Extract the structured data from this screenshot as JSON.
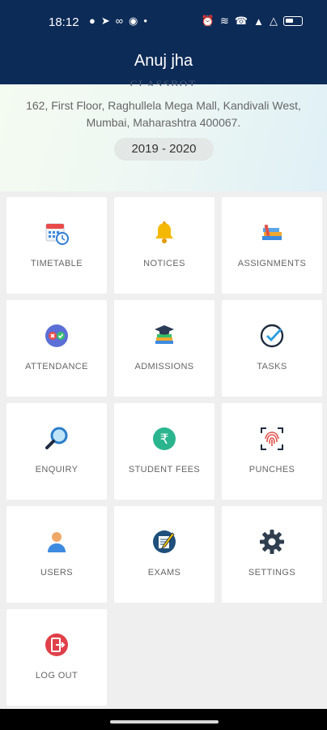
{
  "status_bar": {
    "time": "18:12",
    "left_icons": [
      "chat-icon",
      "telegram-icon",
      "link-icon",
      "messenger-icon",
      "dot-icon"
    ],
    "right_icons": [
      "alarm-icon",
      "wifi-icon",
      "wifi-call-icon",
      "signal-icon",
      "signal-2-icon",
      "battery-icon"
    ]
  },
  "app_bar": {
    "title": "Anuj jha"
  },
  "school": {
    "cut_name": "CLASSBOT",
    "address": "162, First Floor, Raghullela Mega Mall, Kandivali West, Mumbai, Maharashtra 400067.",
    "year": "2019 - 2020"
  },
  "tiles": [
    {
      "label": "TIMETABLE",
      "icon": "calendar-clock-icon"
    },
    {
      "label": "NOTICES",
      "icon": "bell-icon"
    },
    {
      "label": "ASSIGNMENTS",
      "icon": "books-icon"
    },
    {
      "label": "ATTENDANCE",
      "icon": "attendance-icon"
    },
    {
      "label": "ADMISSIONS",
      "icon": "graduation-cap-icon"
    },
    {
      "label": "TASKS",
      "icon": "check-circle-icon"
    },
    {
      "label": "ENQUIRY",
      "icon": "magnifier-icon"
    },
    {
      "label": "STUDENT FEES",
      "icon": "rupee-icon"
    },
    {
      "label": "PUNCHES",
      "icon": "fingerprint-icon"
    },
    {
      "label": "USERS",
      "icon": "user-icon"
    },
    {
      "label": "EXAMS",
      "icon": "exam-pencil-icon"
    },
    {
      "label": "SETTINGS",
      "icon": "gear-icon"
    },
    {
      "label": "LOG OUT",
      "icon": "logout-icon"
    }
  ],
  "colors": {
    "header": "#0d2b57",
    "tile_bg": "#ffffff",
    "page_bg": "#efefef",
    "label": "#666666"
  }
}
